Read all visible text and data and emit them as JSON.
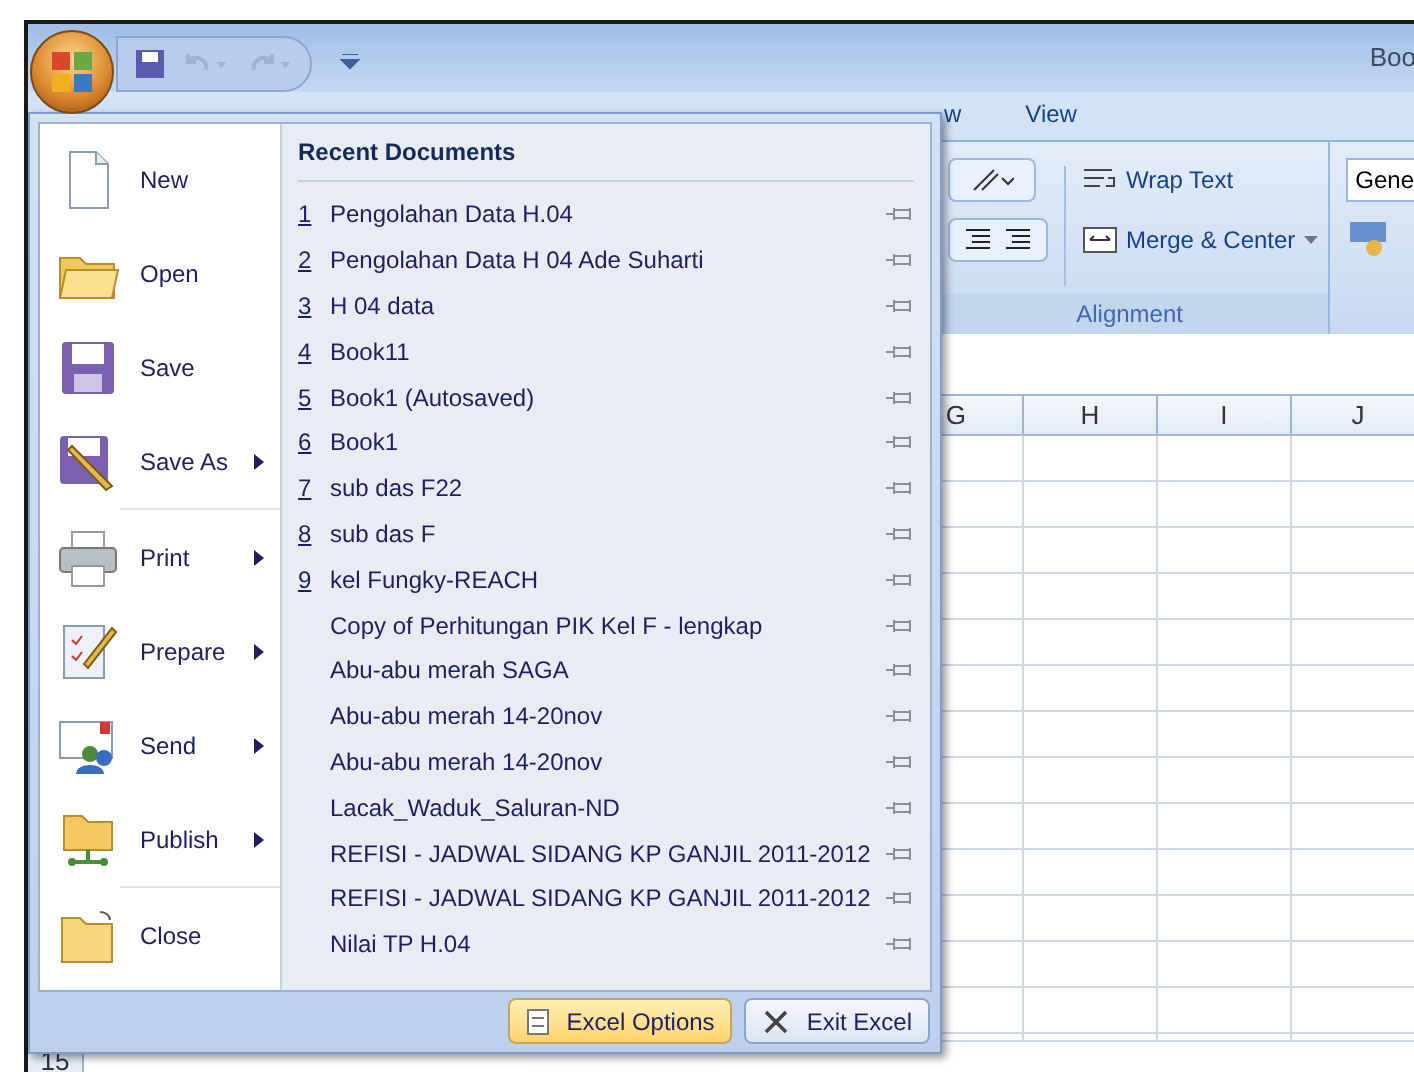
{
  "window": {
    "title": "Boo"
  },
  "ribbon": {
    "tabs": [
      {
        "label": "w",
        "selected": false
      },
      {
        "label": "View",
        "selected": false
      }
    ],
    "alignment_group": {
      "label": "Alignment",
      "buttons": [
        {
          "label": "Wrap Text",
          "kind": "wrap"
        },
        {
          "label": "Merge & Center",
          "kind": "merge"
        }
      ]
    },
    "number_format": {
      "value": "Gene"
    }
  },
  "sheet": {
    "columns": [
      "G",
      "H",
      "I",
      "J"
    ],
    "visible_row": "15"
  },
  "office_menu": {
    "commands": [
      {
        "label": "New",
        "kind": "new",
        "has_submenu": false
      },
      {
        "label": "Open",
        "kind": "open",
        "has_submenu": false
      },
      {
        "label": "Save",
        "kind": "save",
        "has_submenu": false
      },
      {
        "label": "Save As",
        "kind": "saveas",
        "has_submenu": true
      },
      {
        "label": "Print",
        "kind": "print",
        "has_submenu": true
      },
      {
        "label": "Prepare",
        "kind": "prepare",
        "has_submenu": true
      },
      {
        "label": "Send",
        "kind": "send",
        "has_submenu": true
      },
      {
        "label": "Publish",
        "kind": "publish",
        "has_submenu": true
      },
      {
        "label": "Close",
        "kind": "close",
        "has_submenu": false
      }
    ],
    "recent_title": "Recent Documents",
    "recent_documents": [
      {
        "number": "1",
        "name": "Pengolahan Data H.04",
        "pinned": false
      },
      {
        "number": "2",
        "name": "Pengolahan Data H 04 Ade Suharti",
        "pinned": false
      },
      {
        "number": "3",
        "name": "H 04 data",
        "pinned": false
      },
      {
        "number": "4",
        "name": "Book11",
        "pinned": false
      },
      {
        "number": "5",
        "name": "Book1 (Autosaved)",
        "pinned": false
      },
      {
        "number": "6",
        "name": "Book1",
        "pinned": false
      },
      {
        "number": "7",
        "name": "sub das F22",
        "pinned": false
      },
      {
        "number": "8",
        "name": "sub das F",
        "pinned": false
      },
      {
        "number": "9",
        "name": "kel Fungky-REACH",
        "pinned": false
      },
      {
        "name": "Copy of Perhitungan PIK Kel F - lengkap",
        "pinned": false
      },
      {
        "name": "Abu-abu merah SAGA",
        "pinned": false
      },
      {
        "name": "Abu-abu merah 14-20nov",
        "pinned": false
      },
      {
        "name": "Abu-abu merah 14-20nov",
        "pinned": false
      },
      {
        "name": "Lacak_Waduk_Saluran-ND",
        "pinned": false
      },
      {
        "name": "REFISI - JADWAL SIDANG KP GANJIL 2011-2012",
        "pinned": false
      },
      {
        "name": "REFISI - JADWAL SIDANG KP GANJIL 2011-2012",
        "pinned": false
      },
      {
        "name": "Nilai TP H.04",
        "pinned": false
      }
    ],
    "footer_buttons": [
      {
        "label": "Excel Options",
        "kind": "options"
      },
      {
        "label": "Exit Excel",
        "kind": "exit"
      }
    ]
  }
}
